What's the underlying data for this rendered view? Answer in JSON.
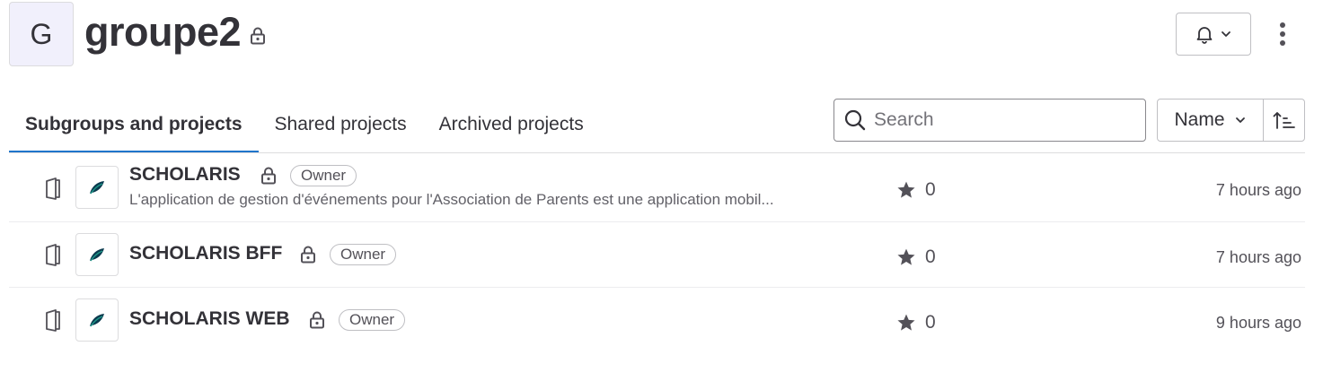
{
  "group": {
    "avatar_letter": "G",
    "title": "groupe2"
  },
  "tabs": [
    {
      "label": "Subgroups and projects",
      "active": true
    },
    {
      "label": "Shared projects",
      "active": false
    },
    {
      "label": "Archived projects",
      "active": false
    }
  ],
  "search": {
    "placeholder": "Search",
    "value": ""
  },
  "sort": {
    "field": "Name",
    "direction": "ascending"
  },
  "projects": [
    {
      "name": "SCHOLARIS",
      "badge": "Owner",
      "description": "L'application de gestion d'événements pour l'Association de Parents est une application mobil...",
      "stars": "0",
      "updated": "7 hours ago"
    },
    {
      "name": "SCHOLARIS BFF",
      "badge": "Owner",
      "description": "",
      "stars": "0",
      "updated": "7 hours ago"
    },
    {
      "name": "SCHOLARIS WEB",
      "badge": "Owner",
      "description": "",
      "stars": "0",
      "updated": "9 hours ago"
    }
  ],
  "colors": {
    "accent": "#1f75cb",
    "avatar_bg": "#f1f0fc",
    "text": "#333238",
    "leaf_dark": "#0b3b4f",
    "leaf_light": "#1f9a8a"
  },
  "icons": {
    "visibility": "lock-icon",
    "project_type": "book-icon",
    "notifications": "bell-icon",
    "more": "kebab-icon",
    "star": "star-icon",
    "search": "search-icon",
    "sort_direction": "sort-ascending-icon"
  }
}
